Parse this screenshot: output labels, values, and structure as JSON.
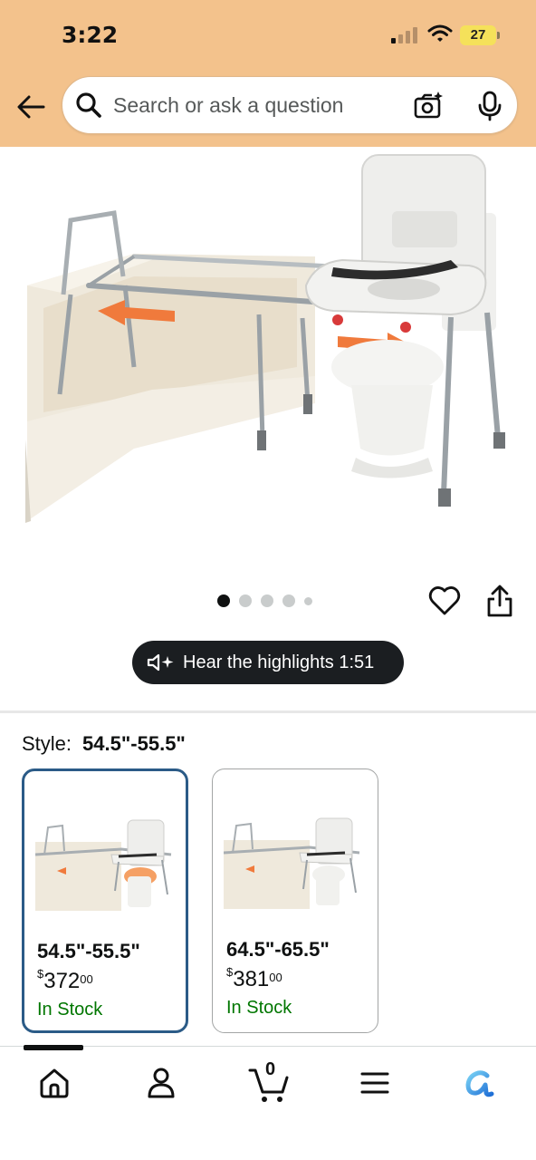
{
  "status_bar": {
    "time": "3:22",
    "battery": "27"
  },
  "header": {
    "back_icon": "back-arrow-icon",
    "search": {
      "placeholder": "Search or ask a question",
      "value": ""
    },
    "camera_icon": "camera-icon",
    "mic_icon": "mic-icon"
  },
  "gallery": {
    "image": "bathtub transfer bench with toilet seat",
    "dot_count": 5,
    "active_dot": 1,
    "wishlist_icon": "heart-icon",
    "share_icon": "share-icon"
  },
  "audio": {
    "label": "Hear the highlights 1:51"
  },
  "style": {
    "label": "Style:",
    "selected": "54.5\"-55.5\"",
    "options": [
      {
        "size": "54.5\"-55.5\"",
        "currency": "$",
        "price_whole": "372",
        "price_cents": "00",
        "availability": "In Stock",
        "selected": true
      },
      {
        "size": "64.5\"-65.5\"",
        "currency": "$",
        "price_whole": "381",
        "price_cents": "00",
        "availability": "In Stock",
        "selected": false
      }
    ]
  },
  "bottom_nav": {
    "cart_count": "0",
    "items": [
      "home-icon",
      "account-icon",
      "cart-icon",
      "menu-icon",
      "rufus-icon"
    ]
  },
  "colors": {
    "header_bg": "#f3c28c",
    "selected_border": "#2b5b87",
    "in_stock": "#007600",
    "audio_button_bg": "#1b1e21"
  }
}
